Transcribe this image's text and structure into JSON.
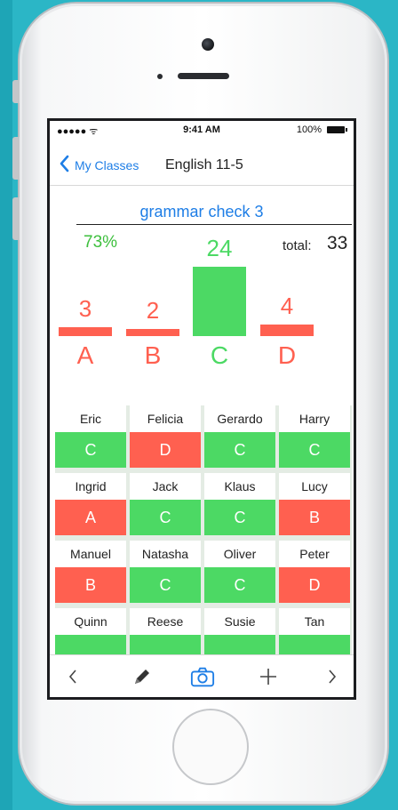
{
  "status_bar": {
    "carrier": "●●●●● ᯤ",
    "time": "9:41 AM",
    "battery": "100%"
  },
  "nav": {
    "back_label": "My Classes",
    "title": "English 11-5"
  },
  "assignment": {
    "title": "grammar check 3",
    "percent": "73%",
    "total_label": "total:",
    "total_value": "33"
  },
  "colors": {
    "accent_blue": "#1e7ee6",
    "correct_green": "#4cd964",
    "wrong_red": "#ff6050",
    "percent_green": "#3dbf3d"
  },
  "chart_data": {
    "type": "bar",
    "categories": [
      "A",
      "B",
      "C",
      "D"
    ],
    "values": [
      3,
      2,
      24,
      4
    ],
    "highlight": "C",
    "colors": {
      "A": "#ff6050",
      "B": "#ff6050",
      "C": "#4cd964",
      "D": "#ff6050"
    }
  },
  "students": [
    {
      "name": "Eric",
      "grade": "C",
      "correct": true
    },
    {
      "name": "Felicia",
      "grade": "D",
      "correct": false
    },
    {
      "name": "Gerardo",
      "grade": "C",
      "correct": true
    },
    {
      "name": "Harry",
      "grade": "C",
      "correct": true
    },
    {
      "name": "Ingrid",
      "grade": "A",
      "correct": false
    },
    {
      "name": "Jack",
      "grade": "C",
      "correct": true
    },
    {
      "name": "Klaus",
      "grade": "C",
      "correct": true
    },
    {
      "name": "Lucy",
      "grade": "B",
      "correct": false
    },
    {
      "name": "Manuel",
      "grade": "B",
      "correct": false
    },
    {
      "name": "Natasha",
      "grade": "C",
      "correct": true
    },
    {
      "name": "Oliver",
      "grade": "C",
      "correct": true
    },
    {
      "name": "Peter",
      "grade": "D",
      "correct": false
    },
    {
      "name": "Quinn",
      "grade": "",
      "correct": true
    },
    {
      "name": "Reese",
      "grade": "",
      "correct": true
    },
    {
      "name": "Susie",
      "grade": "",
      "correct": true
    },
    {
      "name": "Tan",
      "grade": "",
      "correct": true
    }
  ],
  "toolbar": {
    "icons": [
      "chevron-left-icon",
      "pencil-icon",
      "camera-icon",
      "plus-icon",
      "chevron-right-icon"
    ],
    "active": "camera-icon"
  }
}
